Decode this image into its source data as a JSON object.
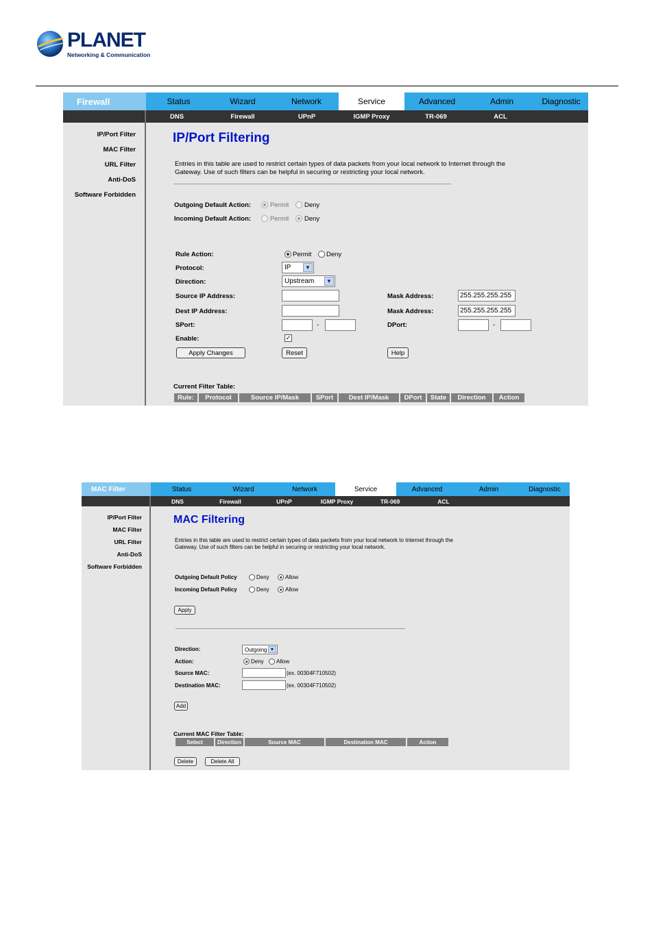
{
  "logo": {
    "word": "PLANET",
    "tagline": "Networking & Communication"
  },
  "panel1": {
    "brand": "Firewall",
    "tabs": [
      {
        "label": "Status",
        "active": false
      },
      {
        "label": "Wizard",
        "active": false
      },
      {
        "label": "Network",
        "active": false
      },
      {
        "label": "Service",
        "active": true
      },
      {
        "label": "Advanced",
        "active": false
      },
      {
        "label": "Admin",
        "active": false
      },
      {
        "label": "Diagnostic",
        "active": false
      }
    ],
    "subtabs": [
      "DNS",
      "Firewall",
      "UPnP",
      "IGMP Proxy",
      "TR-069",
      "ACL"
    ],
    "sidebar": [
      "IP/Port Filter",
      "MAC Filter",
      "URL Filter",
      "Anti-DoS",
      "Software Forbidden"
    ],
    "title": "IP/Port Filtering",
    "description": "Entries in this table are used to restrict certain types of data packets from your local network to Internet through the Gateway. Use of such filters can be helpful in securing or restricting your local network.",
    "outgoing_label": "Outgoing Default Action:",
    "incoming_label": "Incoming Default Action:",
    "permit": "Permit",
    "deny": "Deny",
    "rule_action_label": "Rule Action:",
    "protocol_label": "Protocol:",
    "protocol_value": "IP",
    "direction_label": "Direction:",
    "direction_value": "Upstream",
    "source_ip_label": "Source IP Address:",
    "dest_ip_label": "Dest IP Address:",
    "mask_label": "Mask Address:",
    "mask_value": "255.255.255.255",
    "sport_label": "SPort:",
    "dport_label": "DPort:",
    "dash": "-",
    "enable_label": "Enable:",
    "apply_button": "Apply Changes",
    "reset_button": "Reset",
    "help_button": "Help",
    "table_title": "Current Filter Table:",
    "table_headers": [
      "Rule:",
      "Protocol",
      "Source IP/Mask",
      "SPort",
      "Dest IP/Mask",
      "DPort",
      "State",
      "Direction",
      "Action"
    ]
  },
  "panel2": {
    "brand": "MAC Filter",
    "tabs": [
      {
        "label": "Status",
        "active": false
      },
      {
        "label": "Wizard",
        "active": false
      },
      {
        "label": "Network",
        "active": false
      },
      {
        "label": "Service",
        "active": true
      },
      {
        "label": "Advanced",
        "active": false
      },
      {
        "label": "Admin",
        "active": false
      },
      {
        "label": "Diagnostic",
        "active": false
      }
    ],
    "subtabs": [
      "DNS",
      "Firewall",
      "UPnP",
      "IGMP Proxy",
      "TR-069",
      "ACL"
    ],
    "sidebar": [
      "IP/Port Filter",
      "MAC Filter",
      "URL Filter",
      "Anti-DoS",
      "Software Forbidden"
    ],
    "title": "MAC Filtering",
    "description": "Entries in this table are used to restrict certain types of data packets from your local network to Internet through the Gateway. Use of such filters can be helpful in securing or restricting your local network.",
    "outgoing_label": "Outgoing Default Policy",
    "incoming_label": "Incoming Default Policy",
    "deny": "Deny",
    "allow": "Allow",
    "apply_button": "Apply",
    "direction_label": "Direction:",
    "direction_value": "Outgoing",
    "action_label": "Action:",
    "source_mac_label": "Source MAC:",
    "dest_mac_label": "Destination MAC:",
    "mac_hint": "(ex. 00304F710502)",
    "add_button": "Add",
    "table_title": "Current MAC Filter Table:",
    "table_headers": [
      "Select",
      "Direction",
      "Source MAC",
      "Destination MAC",
      "Action"
    ],
    "delete_button": "Delete",
    "delete_all_button": "Delete All"
  }
}
